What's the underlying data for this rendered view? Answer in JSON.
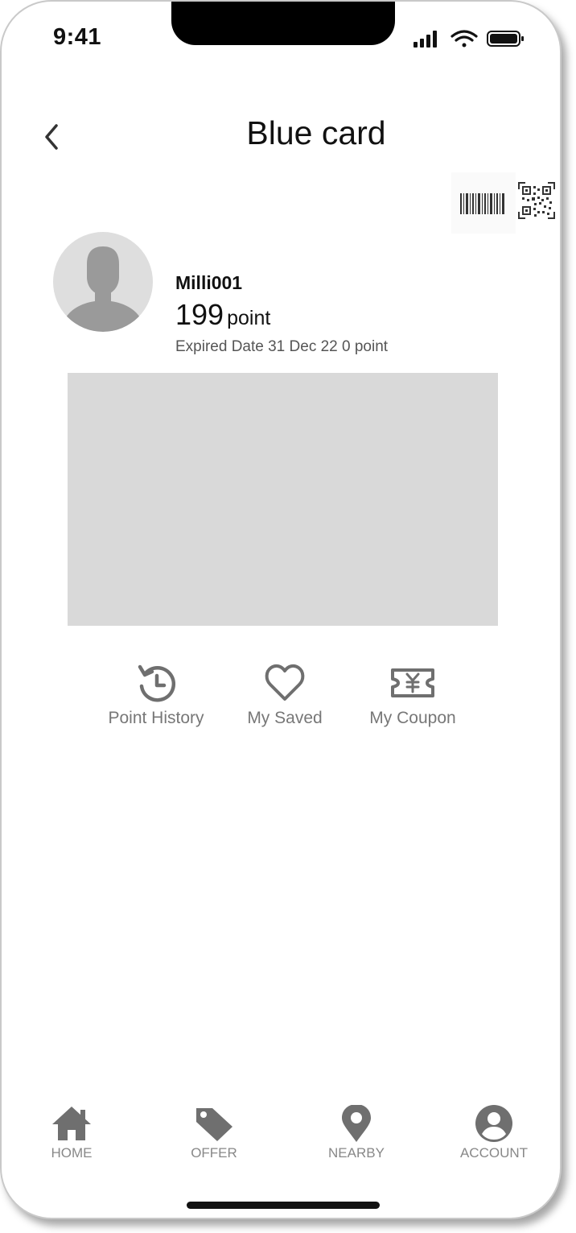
{
  "status_bar": {
    "time": "9:41"
  },
  "header": {
    "title": "Blue card"
  },
  "profile": {
    "username": "Milli001",
    "points_value": "199",
    "points_unit": "point",
    "expiry": "Expired Date 31 Dec 22 0 point"
  },
  "actions": [
    {
      "label": "Point History",
      "icon": "history-icon"
    },
    {
      "label": "My Saved",
      "icon": "heart-icon"
    },
    {
      "label": "My Coupon",
      "icon": "coupon-icon"
    }
  ],
  "bottom_nav": [
    {
      "label": "HOME",
      "icon": "home-icon"
    },
    {
      "label": "OFFER",
      "icon": "tag-icon"
    },
    {
      "label": "NEARBY",
      "icon": "location-pin-icon"
    },
    {
      "label": "ACCOUNT",
      "icon": "account-icon"
    }
  ],
  "colors": {
    "icon_gray": "#6f6f6f",
    "banner": "#d9d9d9",
    "avatar_bg": "#dedede",
    "avatar_fg": "#9a9a9a"
  }
}
